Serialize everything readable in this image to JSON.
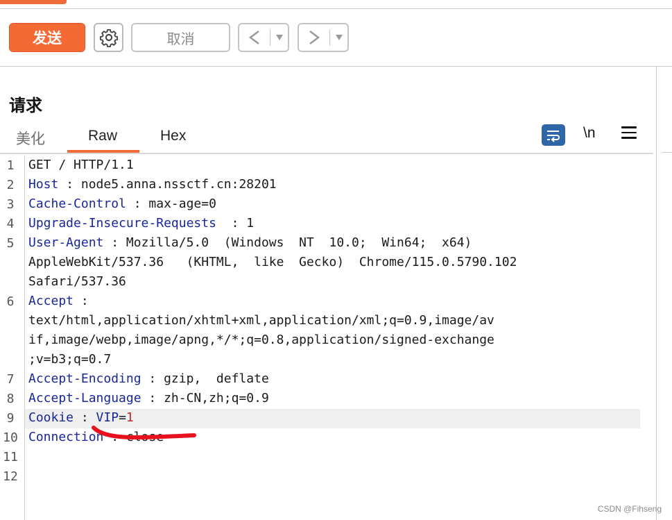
{
  "toolbar": {
    "send_label": "发送",
    "settings_icon": "gear-icon",
    "cancel_label": "取消",
    "back_icon": "chevron-left-icon",
    "forward_icon": "chevron-right-icon",
    "dropdown_icon": "caret-down-icon",
    "colors": {
      "send": "#f46a35",
      "accent": "#ef6b3a"
    }
  },
  "panel": {
    "title": "请求",
    "tabs": [
      {
        "label": "美化"
      },
      {
        "label": "Raw"
      },
      {
        "label": "Hex"
      }
    ],
    "active_tab": "Raw",
    "tools": {
      "wrap_icon": "word-wrap-icon",
      "newline_label": "\\n",
      "menu_icon": "hamburger-menu-icon"
    }
  },
  "editor": {
    "line_numbers": [
      "1",
      "2",
      "3",
      "4",
      "5",
      "6",
      "7",
      "8",
      "9",
      "10",
      "11",
      "12"
    ],
    "lines": {
      "l1": "GET / HTTP/1.1",
      "l2_key": "Host",
      "l2_sep": " : ",
      "l2_val": "node5.anna.nssctf.cn:28201",
      "l3_key": "Cache-Control",
      "l3_sep": " : ",
      "l3_val": "max-age=0",
      "l4_key": "Upgrade-Insecure-Requests",
      "l4_sep": "  : ",
      "l4_val": "1",
      "l5_key": "User-Agent",
      "l5_sep": " : ",
      "l5_val_a": "Mozilla/5.0  (Windows  NT  10.0;  Win64;  x64)",
      "l5_val_b": "AppleWebKit/537.36   (KHTML,  like  Gecko)  Chrome/115.0.5790.102",
      "l5_val_c": "Safari/537.36",
      "l6_key": "Accept",
      "l6_sep": " :",
      "l6_val_a": "text/html,application/xhtml+xml,application/xml;q=0.9,image/av",
      "l6_val_b": "if,image/webp,image/apng,*/*;q=0.8,application/signed-exchange",
      "l6_val_c": ";v=b3;q=0.7",
      "l7_key": "Accept-Encoding",
      "l7_sep": " : ",
      "l7_val": "gzip,  deflate",
      "l8_key": "Accept-Language",
      "l8_sep": " : ",
      "l8_val": "zh-CN,zh;q=0.9",
      "l9_key": "Cookie",
      "l9_sep": " : ",
      "l9_ckey": "VIP",
      "l9_eq": "=",
      "l9_cval": "1",
      "l10_key": "Connection",
      "l10_val": " : close"
    }
  },
  "watermark": "CSDN @Fihseng"
}
